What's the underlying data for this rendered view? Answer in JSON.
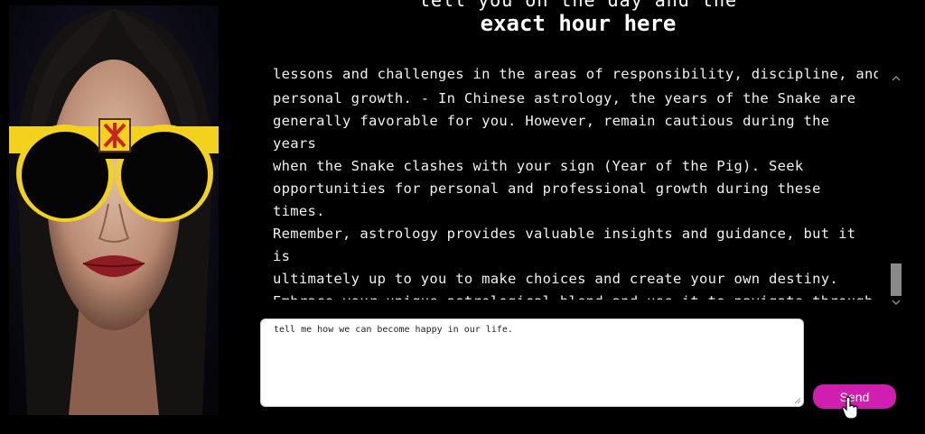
{
  "header": {
    "partial_line": "tell you on the day and the",
    "title": "exact hour here"
  },
  "chat": {
    "clipped_first_line": "lessons and challenges in the areas of responsibility, discipline, and",
    "message_lines": "personal growth. - In Chinese astrology, the years of the Snake are\ngenerally favorable for you. However, remain cautious during the years\nwhen the Snake clashes with your sign (Year of the Pig). Seek\nopportunities for personal and professional growth during these times.\nRemember, astrology provides valuable insights and guidance, but it is\nultimately up to you to make choices and create your own destiny.\nEmbrace your unique astrological blend and use it to navigate through\nlife's ups and downs. Feel free to ask if you have any more questions or\nif there's anything specific you'd like to know."
  },
  "input": {
    "value": "tell me how we can become happy in our life."
  },
  "send_button": {
    "label": "Send"
  },
  "icons": {
    "scroll_up": "chevron-up-icon",
    "scroll_down": "chevron-down-icon",
    "cursor": "hand-pointer-icon"
  },
  "colors": {
    "background": "#000000",
    "send_button": "#d01eb0",
    "sunglasses_frame": "#f2d21c"
  }
}
